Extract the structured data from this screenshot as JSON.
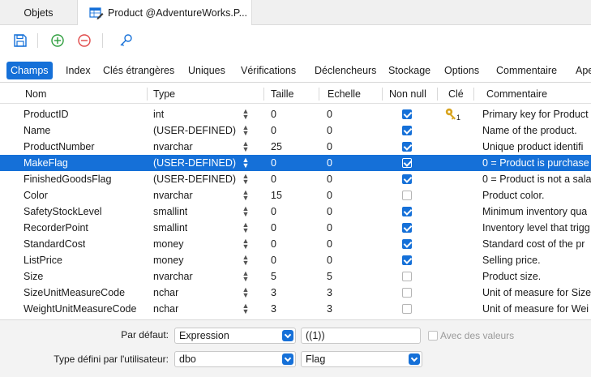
{
  "doc_tabs": [
    {
      "label": "Objets"
    },
    {
      "label": "Product @AdventureWorks.P..."
    }
  ],
  "toolbar": {
    "icons": [
      "save-icon",
      "add-icon",
      "remove-icon",
      "key-icon"
    ],
    "colors": {
      "save": "#1570d8",
      "add": "#2e9e3e",
      "remove": "#e04848",
      "key": "#1570d8"
    }
  },
  "section_tabs": [
    {
      "label": "Champs",
      "active": true
    },
    {
      "label": "Index"
    },
    {
      "label": "Clés étrangères"
    },
    {
      "label": "Uniques"
    },
    {
      "label": "Vérifications"
    },
    {
      "label": "Déclencheurs"
    },
    {
      "label": "Stockage"
    },
    {
      "label": "Options"
    },
    {
      "label": "Commentaire"
    },
    {
      "label": "Ape"
    }
  ],
  "grid": {
    "headers": {
      "name": "Nom",
      "type": "Type",
      "size": "Taille",
      "scale": "Echelle",
      "not_null": "Non null",
      "key": "Clé",
      "comment": "Commentaire"
    },
    "rows": [
      {
        "name": "ProductID",
        "type": "int",
        "size": "0",
        "scale": "0",
        "not_null": true,
        "key": "1",
        "comment": "Primary key for Product"
      },
      {
        "name": "Name",
        "type": "(USER-DEFINED)",
        "size": "0",
        "scale": "0",
        "not_null": true,
        "key": "",
        "comment": "Name of the product."
      },
      {
        "name": "ProductNumber",
        "type": "nvarchar",
        "size": "25",
        "scale": "0",
        "not_null": true,
        "key": "",
        "comment": "Unique product identifi"
      },
      {
        "name": "MakeFlag",
        "type": "(USER-DEFINED)",
        "size": "0",
        "scale": "0",
        "not_null": true,
        "key": "",
        "comment": "0 = Product is purchase",
        "selected": true
      },
      {
        "name": "FinishedGoodsFlag",
        "type": "(USER-DEFINED)",
        "size": "0",
        "scale": "0",
        "not_null": true,
        "key": "",
        "comment": "0 = Product is not a sala"
      },
      {
        "name": "Color",
        "type": "nvarchar",
        "size": "15",
        "scale": "0",
        "not_null": false,
        "key": "",
        "comment": "Product color."
      },
      {
        "name": "SafetyStockLevel",
        "type": "smallint",
        "size": "0",
        "scale": "0",
        "not_null": true,
        "key": "",
        "comment": "Minimum inventory qua"
      },
      {
        "name": "RecorderPoint",
        "type": "smallint",
        "size": "0",
        "scale": "0",
        "not_null": true,
        "key": "",
        "comment": "Inventory level that trigg"
      },
      {
        "name": "StandardCost",
        "type": "money",
        "size": "0",
        "scale": "0",
        "not_null": true,
        "key": "",
        "comment": "Standard cost of the pr"
      },
      {
        "name": "ListPrice",
        "type": "money",
        "size": "0",
        "scale": "0",
        "not_null": true,
        "key": "",
        "comment": "Selling price."
      },
      {
        "name": "Size",
        "type": "nvarchar",
        "size": "5",
        "scale": "5",
        "not_null": false,
        "key": "",
        "comment": "Product size."
      },
      {
        "name": "SizeUnitMeasureCode",
        "type": "nchar",
        "size": "3",
        "scale": "3",
        "not_null": false,
        "key": "",
        "comment": "Unit of measure for Size"
      },
      {
        "name": "WeightUnitMeasureCode",
        "type": "nchar",
        "size": "3",
        "scale": "3",
        "not_null": false,
        "key": "",
        "comment": "Unit of measure for Wei"
      }
    ]
  },
  "bottom": {
    "default_label": "Par défaut:",
    "default_combo": "Expression",
    "default_value": "((1))",
    "with_values_label": "Avec des valeurs",
    "with_values_checked": false,
    "udt_label": "Type défini par l'utilisateur:",
    "udt_schema": "dbo",
    "udt_type": "Flag"
  },
  "colors": {
    "accent": "#1570d8",
    "selection": "#1570d8",
    "key_gold": "#d9a520"
  }
}
